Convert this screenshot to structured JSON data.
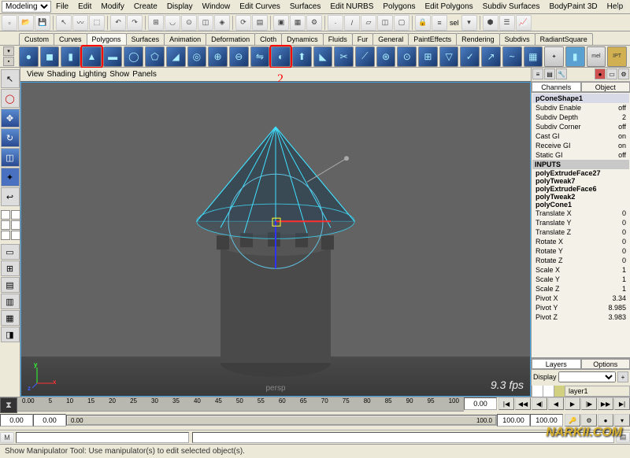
{
  "mode": "Modeling",
  "menu": [
    "File",
    "Edit",
    "Modify",
    "Create",
    "Display",
    "Window",
    "Edit Curves",
    "Surfaces",
    "Edit NURBS",
    "Polygons",
    "Edit Polygons",
    "Subdiv Surfaces",
    "BodyPaint 3D",
    "Help"
  ],
  "cat_tabs": [
    "Custom",
    "Curves",
    "Polygons",
    "Surfaces",
    "Animation",
    "Deformation",
    "Cloth",
    "Dynamics",
    "Fluids",
    "Fur",
    "General",
    "PaintEffects",
    "Rendering",
    "Subdivs",
    "RadiantSquare"
  ],
  "active_cat": "Polygons",
  "shelf_special": {
    "mel": "mel",
    "ipt": "IPT"
  },
  "annotation": "2",
  "vp_menu": [
    "View",
    "Shading",
    "Lighting",
    "Show",
    "Panels"
  ],
  "vp": {
    "fps": "9.3 fps",
    "camera": "persp",
    "axes": {
      "x": "x",
      "y": "y",
      "z": "z"
    }
  },
  "channels": {
    "tabs": [
      "Channels",
      "Object"
    ],
    "shape": "pConeShape1",
    "attrs": [
      {
        "n": "Subdiv Enable",
        "v": "off"
      },
      {
        "n": "Subdiv Depth",
        "v": "2"
      },
      {
        "n": "Subdiv Corner",
        "v": "off"
      },
      {
        "n": "Cast GI",
        "v": "on"
      },
      {
        "n": "Receive GI",
        "v": "on"
      },
      {
        "n": "Static GI",
        "v": "off"
      }
    ],
    "inputs_label": "INPUTS",
    "history": [
      "polyExtrudeFace27",
      "polyTweak7",
      "polyExtrudeFace6",
      "polyTweak2",
      "polyCone1"
    ],
    "xform": [
      {
        "n": "Translate X",
        "v": "0"
      },
      {
        "n": "Translate Y",
        "v": "0"
      },
      {
        "n": "Translate Z",
        "v": "0"
      },
      {
        "n": "Rotate X",
        "v": "0"
      },
      {
        "n": "Rotate Y",
        "v": "0"
      },
      {
        "n": "Rotate Z",
        "v": "0"
      },
      {
        "n": "Scale X",
        "v": "1"
      },
      {
        "n": "Scale Y",
        "v": "1"
      },
      {
        "n": "Scale Z",
        "v": "1"
      },
      {
        "n": "Pivot X",
        "v": "3.34"
      },
      {
        "n": "Pivot Y",
        "v": "8.985"
      },
      {
        "n": "Pivot Z",
        "v": "3.983"
      }
    ],
    "layers_tabs": [
      "Layers",
      "Options"
    ],
    "display_label": "Display",
    "layer1": "layer1"
  },
  "timeline": {
    "ticks": [
      "0.00",
      "5",
      "10",
      "15",
      "20",
      "25",
      "30",
      "35",
      "40",
      "45",
      "50",
      "55",
      "60",
      "65",
      "70",
      "75",
      "80",
      "85",
      "90",
      "95",
      "100"
    ],
    "frame_cur": "0.00",
    "range_start": "0.00",
    "range_end": "100.00",
    "range_disp_start": "0.00",
    "range_disp_end": "100.0"
  },
  "status": "Show Manipulator Tool: Use manipulator(s) to edit selected object(s).",
  "sel_label": "sel",
  "watermark_br": "NARKII.COM"
}
